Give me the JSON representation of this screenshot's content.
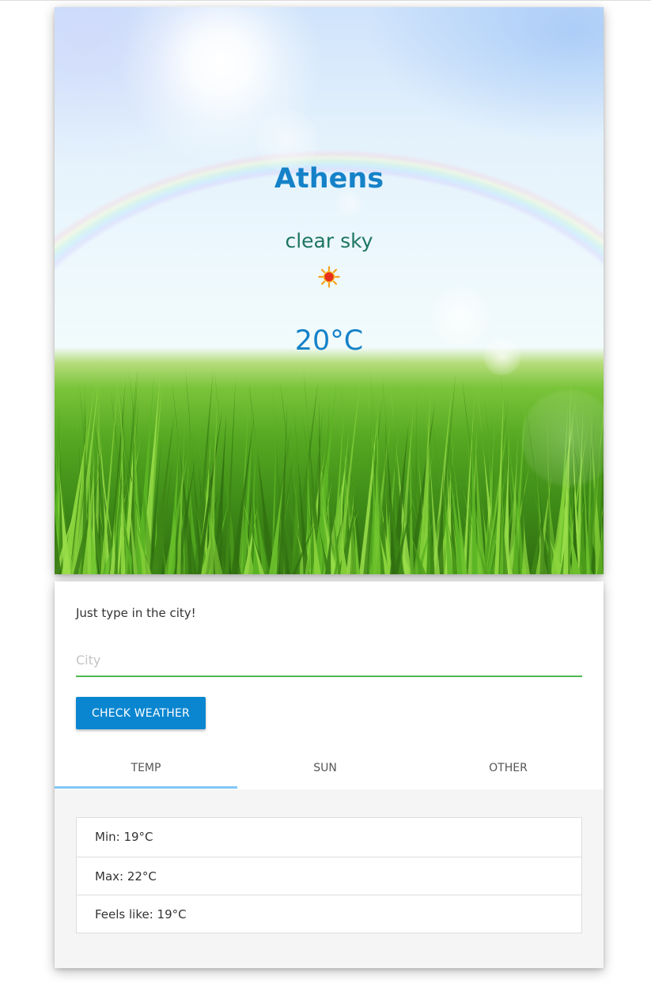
{
  "weather": {
    "city": "Athens",
    "description": "clear sky",
    "icon": "sun-icon",
    "temperature": "20°C"
  },
  "search": {
    "prompt": "Just type in the city!",
    "placeholder": "City",
    "value": "",
    "button_label": "CHECK WEATHER"
  },
  "tabs": [
    {
      "label": "TEMP",
      "active": true
    },
    {
      "label": "SUN",
      "active": false
    },
    {
      "label": "OTHER",
      "active": false
    }
  ],
  "details": [
    {
      "text": "Min: 19°C"
    },
    {
      "text": "Max: 22°C"
    },
    {
      "text": "Feels like: 19°C"
    }
  ],
  "colors": {
    "accent": "#0a86d0",
    "city_text": "#1582c8",
    "description_text": "#1d7562",
    "input_underline": "#4cb84c",
    "tab_indicator": "#7fc7f5"
  }
}
